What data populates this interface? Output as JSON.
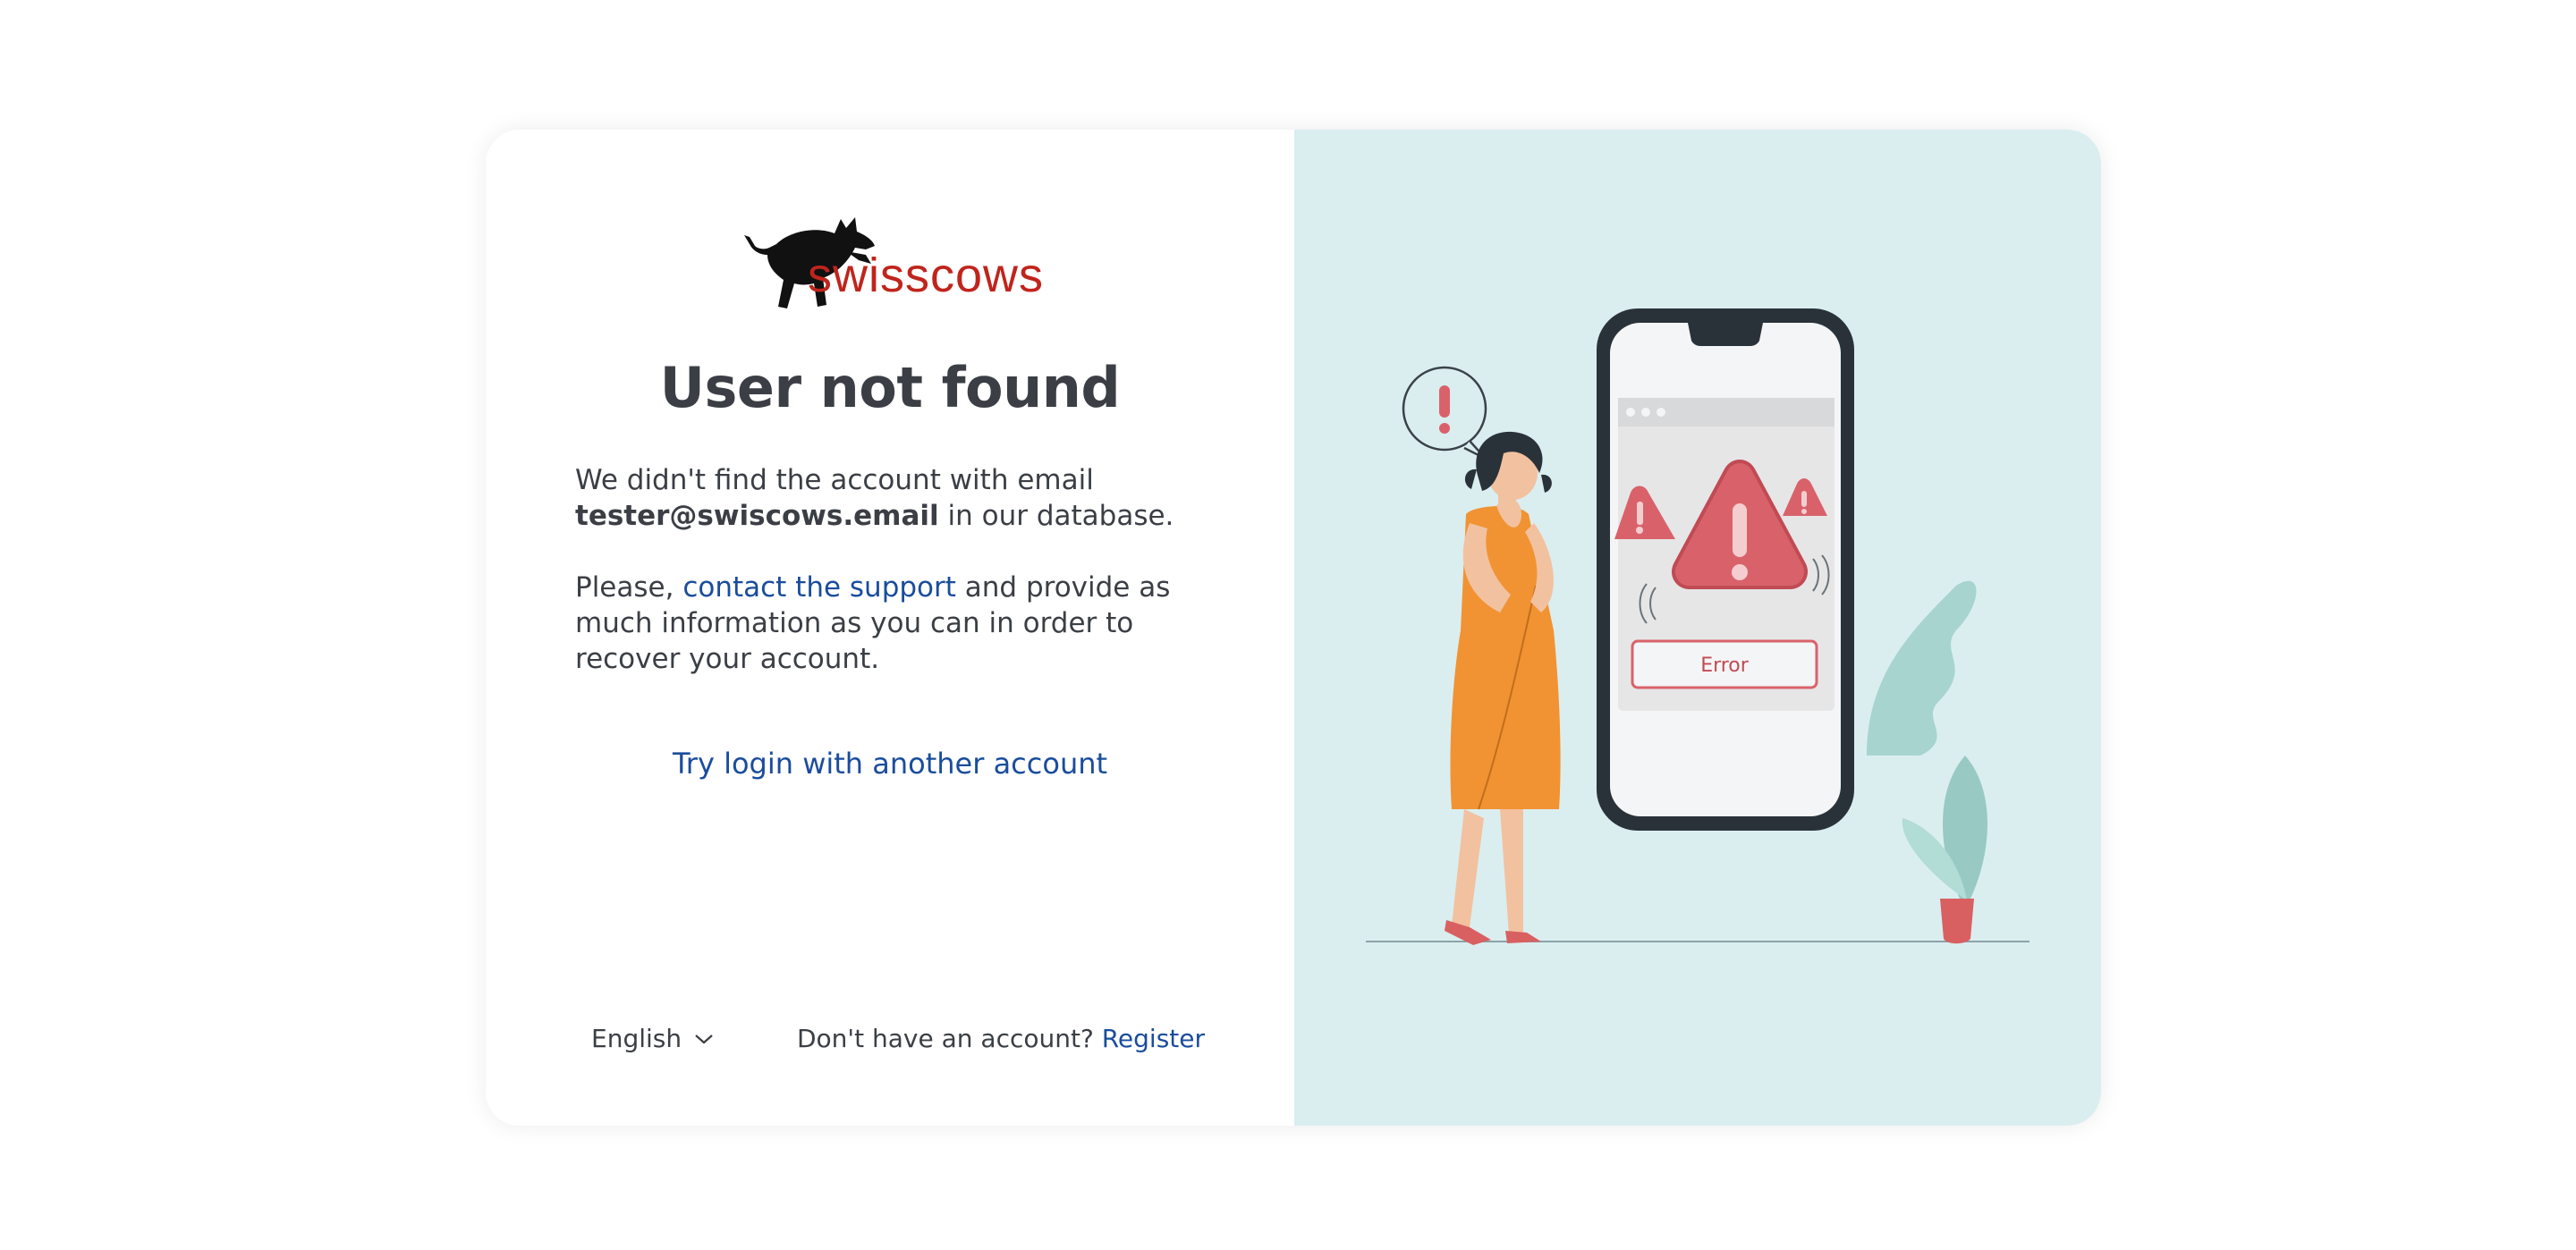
{
  "logo": {
    "text": "swisscows",
    "brand_color": "#c0241c"
  },
  "main": {
    "title": "User not found",
    "message_prefix": "We didn't find the account with email",
    "email": "tester@swiscows.email",
    "message_suffix": " in our database.",
    "support_prefix": "Please, ",
    "support_link": "contact the support",
    "support_suffix": " and provide as much information as you can in order to recover your account.",
    "try_link": "Try login with another account"
  },
  "footer": {
    "language": "English",
    "no_account_text": "Don't have an account? ",
    "register_link": "Register"
  },
  "illustration": {
    "error_button_label": "Error"
  },
  "colors": {
    "link": "#1a4d9c",
    "right_panel_bg": "#daeef0",
    "title_text": "#3b3f45",
    "error_red": "#d9626a",
    "dress_orange": "#f19333"
  }
}
